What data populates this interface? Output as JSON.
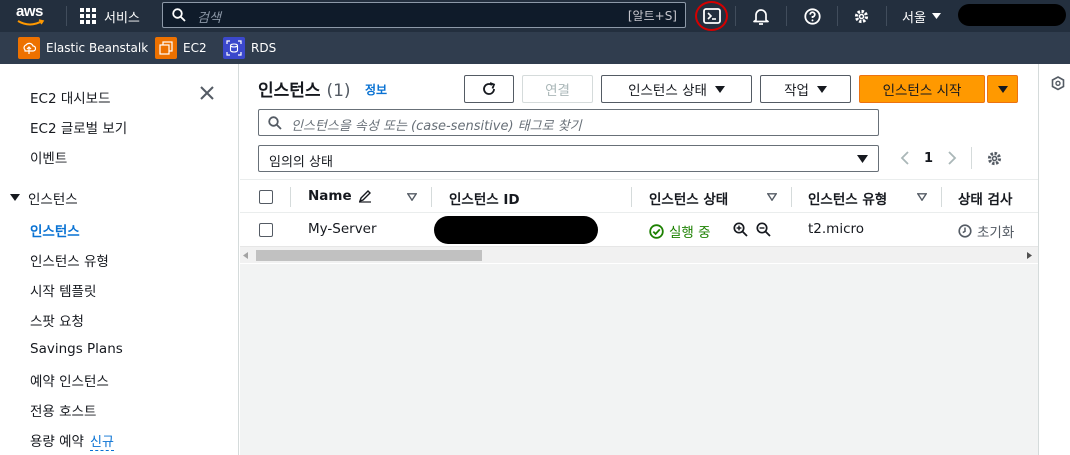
{
  "topnav": {
    "logo_text": "aws",
    "services_label": "서비스",
    "search_placeholder": "검색",
    "search_shortcut": "[알트+S]",
    "region_label": "서울",
    "icons": [
      "cloudshell-icon",
      "bell-icon",
      "help-icon",
      "gear-icon"
    ]
  },
  "favorites": [
    {
      "label": "Elastic Beanstalk",
      "color": "#ed7100"
    },
    {
      "label": "EC2",
      "color": "#ed7100"
    },
    {
      "label": "RDS",
      "color": "#3b48cc"
    }
  ],
  "sidebar": {
    "items_top": [
      "EC2 대시보드",
      "EC2 글로벌 보기",
      "이벤트"
    ],
    "section": "인스턴스",
    "items": [
      "인스턴스",
      "인스턴스 유형",
      "시작 템플릿",
      "스팟 요청",
      "Savings Plans",
      "예약 인스턴스",
      "전용 호스트",
      "용량 예약"
    ],
    "new_badge": "신규"
  },
  "main": {
    "title": "인스턴스",
    "count": "(1)",
    "info_link": "정보",
    "buttons": {
      "connect": "연결",
      "instance_state": "인스턴스 상태",
      "actions": "작업",
      "launch": "인스턴스 시작"
    },
    "filter_placeholder": "인스턴스을 속성 또는 (case-sensitive) 태그로 찾기",
    "state_select": "임의의 상태",
    "page": "1",
    "columns": [
      "Name",
      "인스턴스 ID",
      "인스턴스 상태",
      "인스턴스 유형",
      "상태 검사"
    ],
    "rows": [
      {
        "name": "My-Server",
        "state": "실행 중",
        "type": "t2.micro",
        "check": "초기화"
      }
    ]
  },
  "colors": {
    "nav_bg": "#232f3e",
    "favbar_bg": "#303d4e",
    "accent_orange": "#ff9900",
    "link_blue": "#0972d3",
    "running_green": "#1d8102",
    "highlight_red": "#d40000"
  }
}
